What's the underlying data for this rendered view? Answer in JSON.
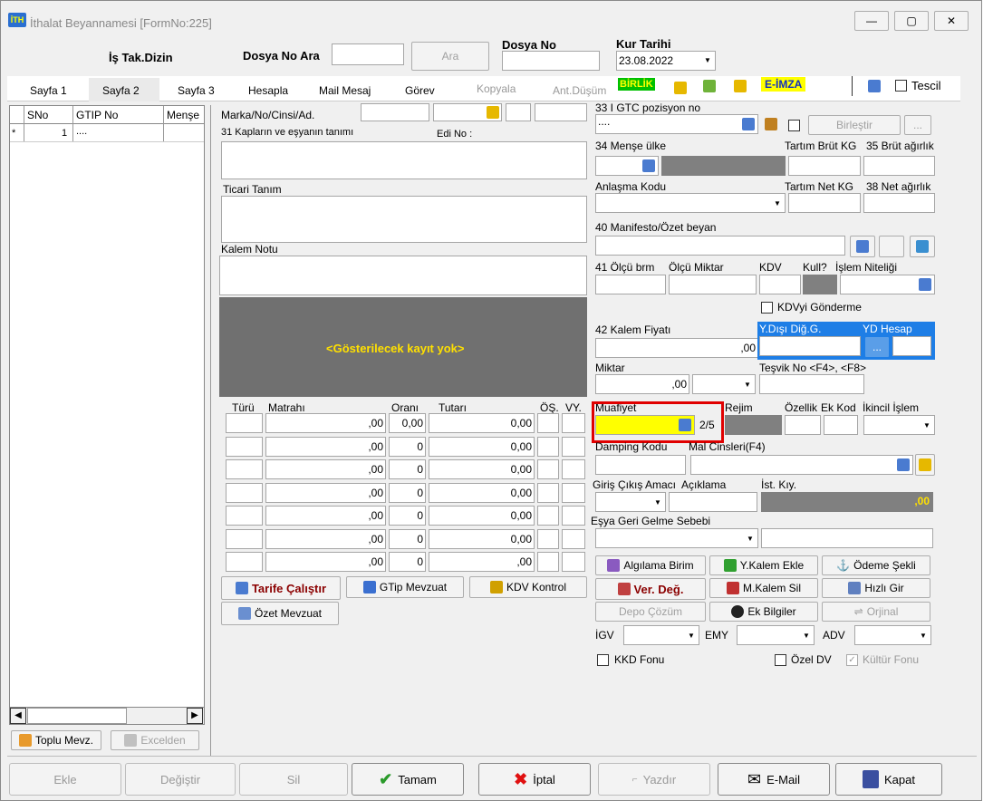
{
  "window": {
    "title": "İthalat Beyannamesi [FormNo:225]",
    "minimize": "—",
    "maximize": "▢",
    "close": "✕"
  },
  "header": {
    "is_takip": "İş Tak.Dizin",
    "dosya_no_ara": "Dosya No Ara",
    "ara_button": "Ara",
    "dosya_no_label": "Dosya No",
    "dosya_no_value": "",
    "kur_tarihi_label": "Kur Tarihi",
    "kur_tarihi_value": "23.08.2022"
  },
  "tabs": {
    "sayfa1": "Sayfa 1",
    "sayfa2": "Sayfa 2",
    "sayfa3": "Sayfa 3",
    "hesapla": "Hesapla",
    "mail_mesaj": "Mail Mesaj",
    "gorev": "Görev",
    "kopyala": "Kopyala",
    "ant_dusum": "Ant.Düşüm",
    "birlik": "BİRLİK",
    "e_imza": "E-İMZA",
    "tescil": "Tescil"
  },
  "grid": {
    "columns": [
      "SNo",
      "GTIP No",
      "Menşe"
    ],
    "rows": [
      {
        "marker": "*",
        "sno": "1",
        "gtip": "...."
      }
    ]
  },
  "left_buttons": {
    "toplu_mevz": "Toplu Mevz.",
    "excelden": "Excelden"
  },
  "fields": {
    "marka": "Marka/No/Cinsi/Ad.",
    "kaplar": "31 Kapların ve eşyanın tanımı",
    "edi_no": "Edi No :",
    "ticari_tanim": "Ticari Tanım",
    "kalem_notu": "Kalem Notu",
    "no_records": "<Gösterilecek kayıt yok>",
    "gtc": "33 I GTC pozisyon no",
    "gtc_value": "....",
    "birlestir": "Birleştir",
    "dots": "...",
    "mense_ulke": "34 Menşe ülke",
    "tartim_brut": "Tartım Brüt KG",
    "brut_agirlik": "35 Brüt ağırlık",
    "anlasma_kodu": "Anlaşma Kodu",
    "tartim_net": "Tartım Net KG",
    "net_agirlik": "38 Net ağırlık",
    "manifesto": "40 Manifesto/Özet beyan",
    "olcu_brm": "41 Ölçü brm",
    "olcu_miktar": "Ölçü Miktar",
    "kdv": "KDV",
    "kull": "Kull?",
    "islem_niteligi": "İşlem Niteliği",
    "kdvyi_gonderme": "KDVyi Gönderme",
    "kalem_fiyati": "42 Kalem Fiyatı",
    "kalem_fiyati_value": ",00",
    "ydisi_dig": "Y.Dışı Diğ.G.",
    "yd_hesap": "YD Hesap",
    "miktar": "Miktar",
    "miktar_value": ",00",
    "tesvik_no": "Teşvik No <F4>, <F8>",
    "muafiyet": "Muafiyet",
    "muafiyet_count": "2/5",
    "rejim": "Rejim",
    "ozellik": "Özellik",
    "ek_kod": "Ek Kod",
    "ikincil_islem": "İkincil İşlem",
    "damping_kodu": "Damping Kodu",
    "mal_cinsleri": "Mal Cinsleri(F4)",
    "giris_cikis": "Giriş Çıkış Amacı",
    "aciklama": "Açıklama",
    "ist_kiy": "İst. Kıy.",
    "ist_kiy_value": ",00",
    "esya_geri": "Eşya Geri Gelme Sebebi"
  },
  "tax_table": {
    "headers": {
      "turu": "Türü",
      "matrahi": "Matrahı",
      "orani": "Oranı",
      "tutari": "Tutarı",
      "os": "ÖŞ.",
      "vy": "VY."
    },
    "rows": [
      {
        "matrah": ",00",
        "oran": "0,00",
        "tutar": "0,00"
      },
      {
        "matrah": ",00",
        "oran": "0",
        "tutar": "0,00"
      },
      {
        "matrah": ",00",
        "oran": "0",
        "tutar": "0,00"
      },
      {
        "matrah": ",00",
        "oran": "0",
        "tutar": "0,00"
      },
      {
        "matrah": ",00",
        "oran": "0",
        "tutar": "0,00"
      },
      {
        "matrah": ",00",
        "oran": "0",
        "tutar": "0,00"
      },
      {
        "matrah": ",00",
        "oran": "0",
        "tutar": ",00"
      }
    ]
  },
  "mid_buttons": {
    "tarife": "Tarife Çalıştır",
    "gtip_mevzuat": "GTip Mevzuat",
    "kdv_kontrol": "KDV Kontrol",
    "ozet_mevzuat": "Özet Mevzuat"
  },
  "right_buttons": {
    "algilama": "Algılama Birim",
    "yeni_kalem": "Y.Kalem Ekle",
    "odeme_sekli": "Ödeme Şekli",
    "ver_deg": "Ver. Değ.",
    "kalem_sil": "M.Kalem Sil",
    "hizli_gir": "Hızlı Gir",
    "depo_cozum": "Depo Çözüm",
    "ek_bilgiler": "Ek Bilgiler",
    "orjinal": "Orjinal"
  },
  "bottom_fields": {
    "igv": "İGV",
    "emy": "EMY",
    "adv": "ADV",
    "kkd_fonu": "KKD Fonu",
    "ozel_dv": "Özel DV",
    "kultur_fonu": "Kültür Fonu"
  },
  "footer": {
    "ekle": "Ekle",
    "degistir": "Değiştir",
    "sil": "Sil",
    "tamam": "Tamam",
    "iptal": "İptal",
    "yazdir": "Yazdır",
    "email": "E-Mail",
    "kapat": "Kapat"
  }
}
